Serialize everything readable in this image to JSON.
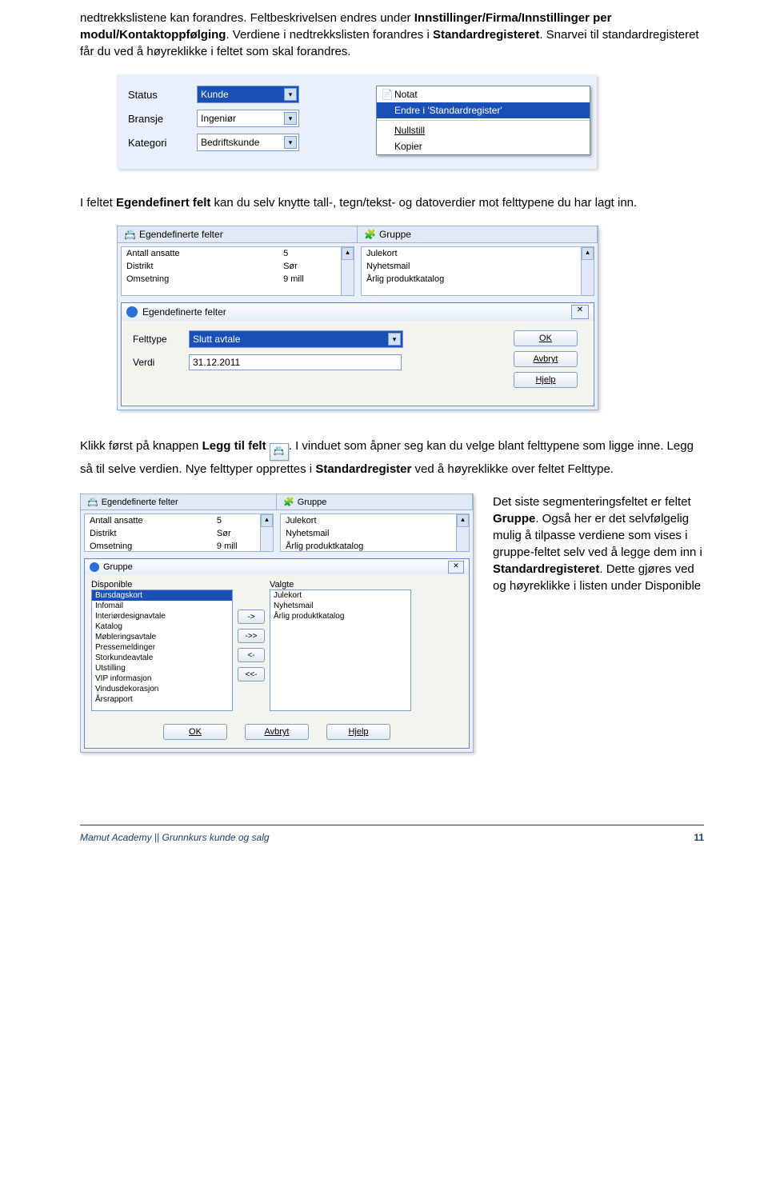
{
  "para1": {
    "a": "nedtrekkslistene kan forandres. Feltbeskrivelsen endres under ",
    "b": "Innstillinger/Firma/Innstillinger per modul/Kontaktoppfølging",
    "c": ". Verdiene i nedtrekkslisten forandres i ",
    "d": "Standardregisteret",
    "e": ". Snarvei til standardregisteret får du ved å høyreklikke i feltet som skal forandres."
  },
  "shot1": {
    "labels": {
      "status": "Status",
      "bransje": "Bransje",
      "kategori": "Kategori"
    },
    "values": {
      "status": "Kunde",
      "bransje": "Ingeniør",
      "kategori": "Bedriftskunde"
    },
    "menu": {
      "notat": "Notat",
      "endre": "Endre i 'Standardregister'",
      "nullstill": "Nullstill",
      "kopier": "Kopier"
    }
  },
  "para2": {
    "a": "I feltet ",
    "b": "Egendefinert felt",
    "c": " kan du selv knytte tall-, tegn/tekst- og datoverdier mot felttypene du har lagt inn."
  },
  "shot2": {
    "tab1": "Egendefinerte felter",
    "tab2": "Gruppe",
    "rows_left": [
      [
        "Antall ansatte",
        "5"
      ],
      [
        "Distrikt",
        "Sør"
      ],
      [
        "Omsetning",
        "9 mill"
      ]
    ],
    "rows_right": [
      "Julekort",
      "Nyhetsmail",
      "Årlig produktkatalog"
    ],
    "dlg": {
      "title": "Egendefinerte felter",
      "lbl_felttype": "Felttype",
      "lbl_verdi": "Verdi",
      "felttype_value": "Slutt avtale",
      "verdi_value": "31.12.2011",
      "btn_ok": "OK",
      "btn_cancel": "Avbryt",
      "btn_help": "Hjelp"
    }
  },
  "para3": {
    "a": "Klikk først på knappen ",
    "b": "Legg til felt",
    "c": " ",
    "d": ". I vinduet som åpner seg kan du velge blant felttypene som ligge inne. Legg så til selve verdien. Nye felttyper opprettes i ",
    "e": "Standardregister",
    "f": " ved å høyreklikke over feltet Felttype."
  },
  "shot3": {
    "tab1": "Egendefinerte felter",
    "tab2": "Gruppe",
    "top_left": [
      [
        "Antall ansatte",
        "5"
      ],
      [
        "Distrikt",
        "Sør"
      ],
      [
        "Omsetning",
        "9 mill"
      ]
    ],
    "top_right": [
      "Julekort",
      "Nyhetsmail",
      "Årlig produktkatalog"
    ],
    "dlg": {
      "title": "Gruppe",
      "lbl_disp": "Disponible",
      "lbl_valgte": "Valgte",
      "disp": [
        "Bursdagskort",
        "Infomail",
        "Interiørdesignavtale",
        "Katalog",
        "Møbleringsavtale",
        "Pressemeldinger",
        "Storkundeavtale",
        "Utstilling",
        "VIP informasjon",
        "Vindusdekorasjon",
        "Årsrapport"
      ],
      "valgte": [
        "Julekort",
        "Nyhetsmail",
        "Årlig produktkatalog"
      ],
      "btn_ok": "OK",
      "btn_cancel": "Avbryt",
      "btn_help": "Hjelp",
      "move": {
        "r": "->",
        "rr": "->>",
        "l": "<-",
        "ll": "<<-"
      }
    }
  },
  "para4": {
    "a": "Det siste segmenteringsfeltet er feltet ",
    "b": "Gruppe",
    "c": ". Også her er det selvfølgelig mulig å tilpasse verdiene som vises i gruppe-feltet selv ved å legge dem inn i ",
    "d": "Standardregisteret",
    "e": ". Dette gjøres ved og høyreklikke i listen under Disponible"
  },
  "footer": {
    "text": "Mamut Academy || Grunnkurs kunde og salg",
    "page": "11"
  }
}
